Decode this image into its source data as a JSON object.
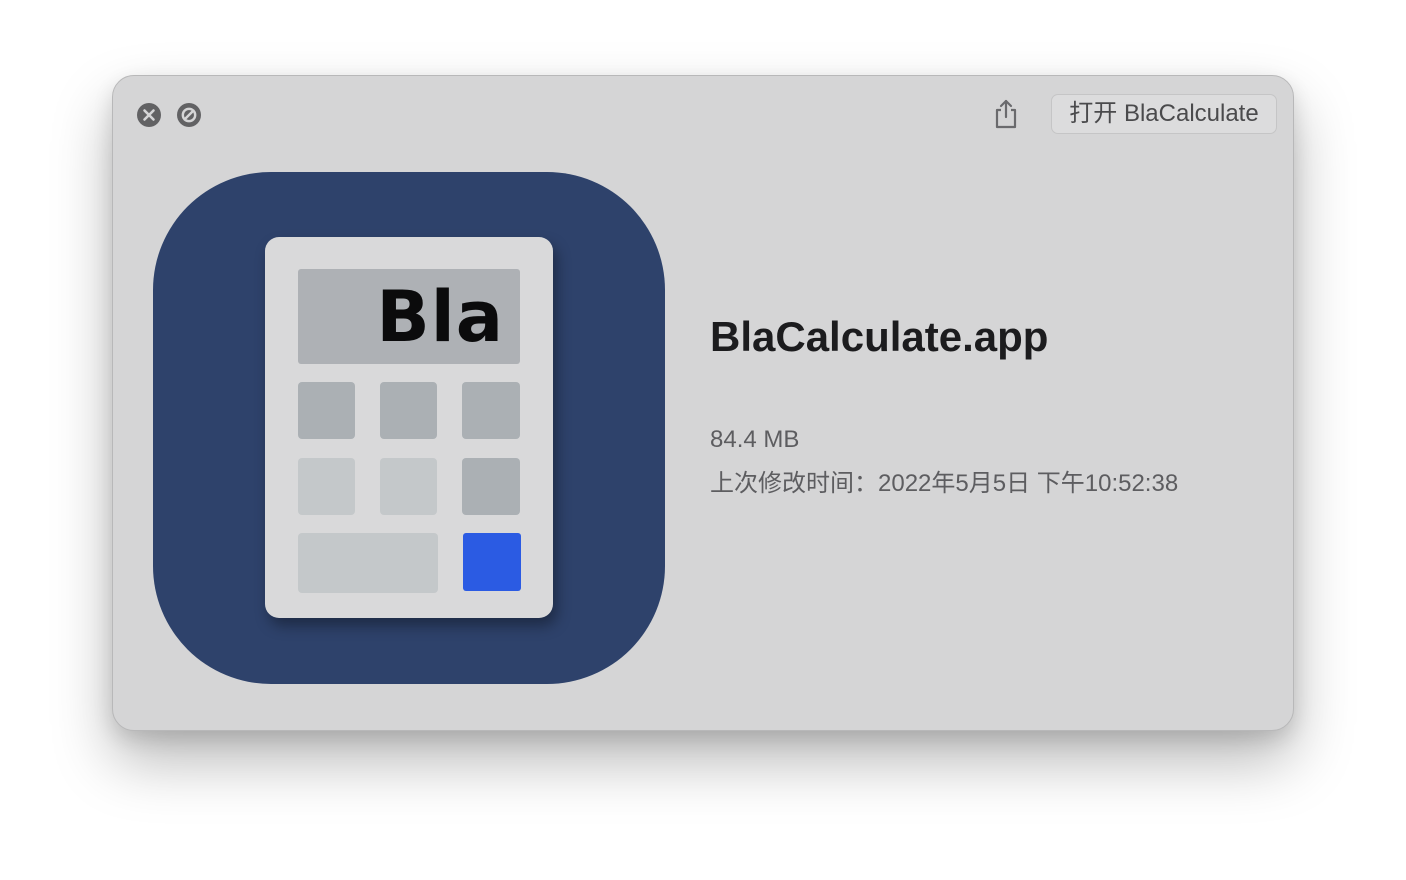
{
  "toolbar": {
    "close_icon": "close-circle-icon",
    "disable_icon": "prohibited-circle-icon",
    "share_icon": "share-icon",
    "open_button_label": "打开 BlaCalculate"
  },
  "app_icon": {
    "display_text": "Bla",
    "background_color": "#2e426b",
    "accent_key_color": "#2b5be3"
  },
  "file_info": {
    "name": "BlaCalculate.app",
    "size": "84.4 MB",
    "modified": "上次修改时间：2022年5月5日 下午10:52:38"
  }
}
